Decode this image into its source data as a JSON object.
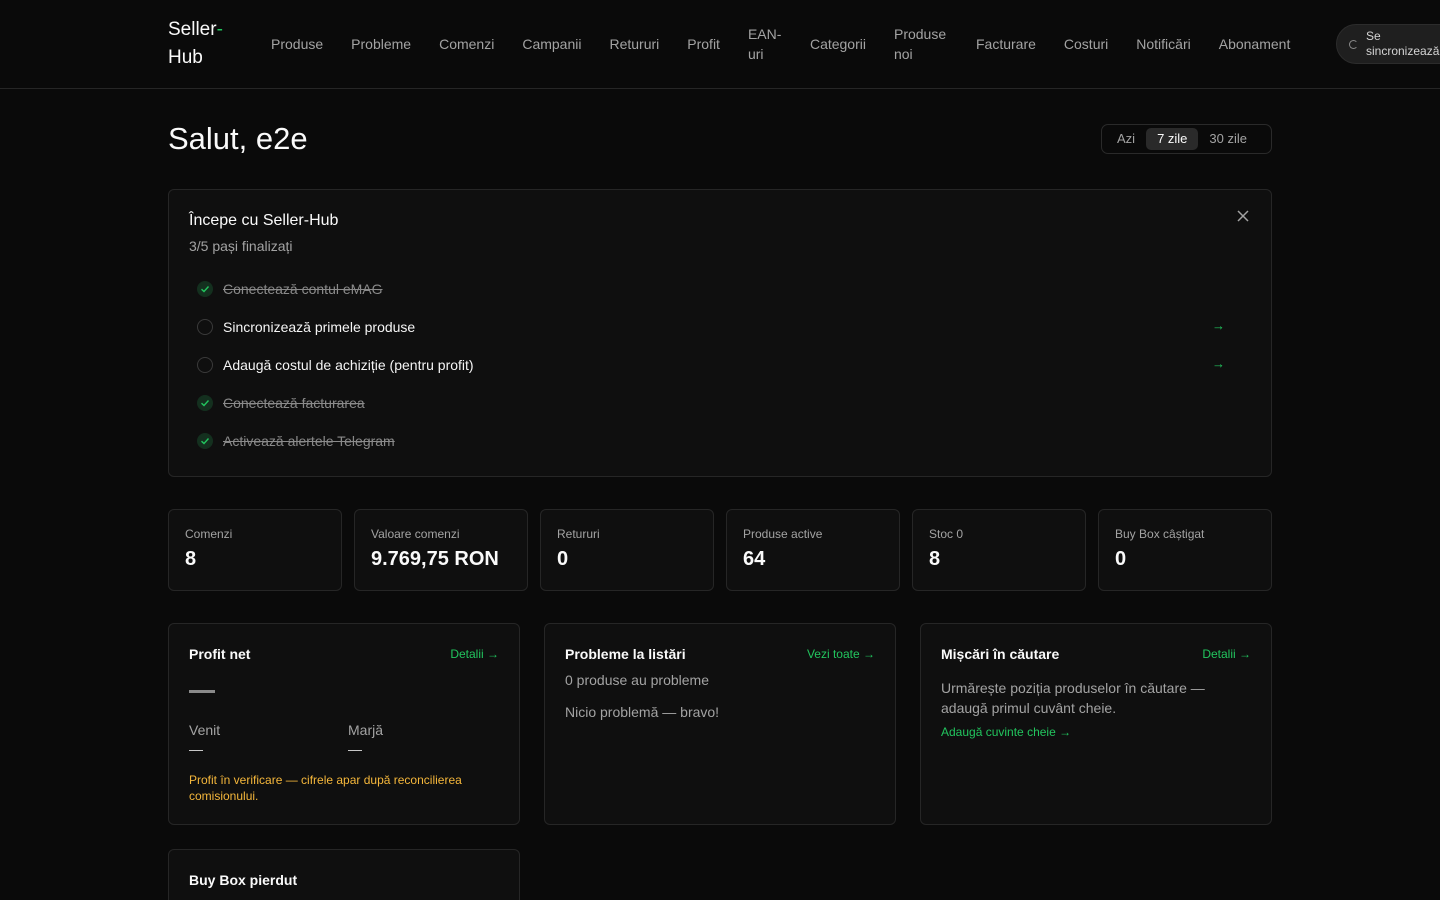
{
  "header": {
    "logo_main": "Seller",
    "logo_dash": "-",
    "logo_second": "Hub",
    "nav": [
      {
        "label": "Produse"
      },
      {
        "label": "Probleme"
      },
      {
        "label": "Comenzi"
      },
      {
        "label": "Campanii"
      },
      {
        "label": "Retururi"
      },
      {
        "label": "Profit"
      },
      {
        "label": "EAN-uri"
      },
      {
        "label": "Categorii"
      },
      {
        "label": "Produse noi"
      },
      {
        "label": "Facturare"
      },
      {
        "label": "Costuri"
      },
      {
        "label": "Notificări"
      },
      {
        "label": "Abonament"
      }
    ],
    "sync_label": "Se sincronizează"
  },
  "greeting": "Salut, e2e",
  "range": {
    "options": [
      "Azi",
      "7 zile",
      "30 zile"
    ],
    "selected": "7 zile"
  },
  "onboarding": {
    "title": "Începe cu Seller-Hub",
    "progress": "3/5 pași finalizați",
    "steps": [
      {
        "label": "Conectează contul eMAG",
        "done": true
      },
      {
        "label": "Sincronizează primele produse",
        "done": false
      },
      {
        "label": "Adaugă costul de achiziție (pentru profit)",
        "done": false
      },
      {
        "label": "Conectează facturarea",
        "done": true
      },
      {
        "label": "Activează alertele Telegram",
        "done": true
      }
    ]
  },
  "stats": [
    {
      "label": "Comenzi",
      "value": "8"
    },
    {
      "label": "Valoare comenzi",
      "value": "9.769,75 RON"
    },
    {
      "label": "Retururi",
      "value": "0"
    },
    {
      "label": "Produse active",
      "value": "64"
    },
    {
      "label": "Stoc 0",
      "value": "8"
    },
    {
      "label": "Buy Box câștigat",
      "value": "0"
    }
  ],
  "profit": {
    "title": "Profit net",
    "link": "Detalii →",
    "revenue_label": "Venit",
    "revenue_value": "—",
    "margin_label": "Marjă",
    "margin_value": "—",
    "warning": "Profit în verificare — cifrele apar după reconcilierea comisionului."
  },
  "issues": {
    "title": "Probleme la listări",
    "link": "Vezi toate →",
    "count_text": "0 produse au probleme",
    "empty_text": "Nicio problemă — bravo!"
  },
  "search": {
    "title": "Mișcări în căutare",
    "link": "Detalii →",
    "text": "Urmărește poziția produselor în căutare — adaugă primul cuvânt cheie.",
    "cta": "Adaugă cuvinte cheie →"
  },
  "buybox_lost": {
    "title": "Buy Box pierdut"
  },
  "colors": {
    "accent": "#22c55e",
    "warning": "#f5b73b",
    "background": "#0a0a0a"
  }
}
